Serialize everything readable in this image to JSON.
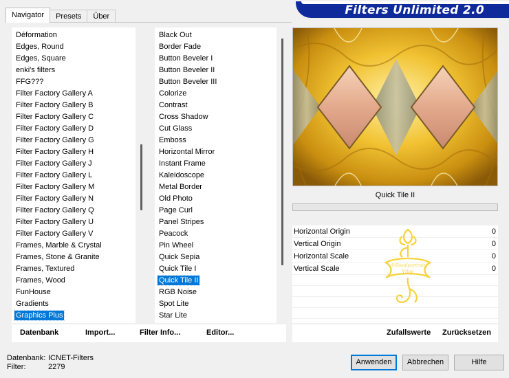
{
  "tabs": [
    "Navigator",
    "Presets",
    "Über"
  ],
  "banner_title": "Filters Unlimited 2.0",
  "categories": [
    "Déformation",
    "Edges, Round",
    "Edges, Square",
    "enki's filters",
    "FFG???",
    "Filter Factory Gallery A",
    "Filter Factory Gallery B",
    "Filter Factory Gallery C",
    "Filter Factory Gallery D",
    "Filter Factory Gallery G",
    "Filter Factory Gallery H",
    "Filter Factory Gallery J",
    "Filter Factory Gallery L",
    "Filter Factory Gallery M",
    "Filter Factory Gallery N",
    "Filter Factory Gallery Q",
    "Filter Factory Gallery U",
    "Filter Factory Gallery V",
    "Frames, Marble & Crystal",
    "Frames, Stone & Granite",
    "Frames, Textured",
    "Frames, Wood",
    "FunHouse",
    "Gradients",
    "Graphics Plus"
  ],
  "category_selected_index": 24,
  "filters": [
    "Black Out",
    "Border Fade",
    "Button Beveler I",
    "Button Beveler II",
    "Button Beveler III",
    "Colorize",
    "Contrast",
    "Cross Shadow",
    "Cut Glass",
    "Emboss",
    "Horizontal Mirror",
    "Instant Frame",
    "Kaleidoscope",
    "Metal Border",
    "Old Photo",
    "Page Curl",
    "Panel Stripes",
    "Peacock",
    "Pin Wheel",
    "Quick Sepia",
    "Quick Tile I",
    "Quick Tile II",
    "RGB Noise",
    "Spot Lite",
    "Star Lite"
  ],
  "filter_selected_index": 21,
  "preview_name": "Quick Tile II",
  "params": [
    {
      "label": "Horizontal Origin",
      "value": "0"
    },
    {
      "label": "Vertical Origin",
      "value": "0"
    },
    {
      "label": "Horizontal Scale",
      "value": "0"
    },
    {
      "label": "Vertical Scale",
      "value": "0"
    }
  ],
  "actions_left": [
    "Datenbank",
    "Import...",
    "Filter Info...",
    "Editor..."
  ],
  "actions_right": [
    "Zufallswerte",
    "Zurücksetzen"
  ],
  "status": {
    "db_label": "Datenbank:",
    "db_value": "ICNET-Filters",
    "filter_label": "Filter:",
    "filter_value": "2279"
  },
  "buttons": {
    "apply": "Anwenden",
    "cancel": "Abbrechen",
    "help": "Hilfe"
  },
  "watermark_text": "©Rosalportrait Vitae",
  "colors": {
    "banner": "#0e2a9b",
    "selection": "#0078d7",
    "default_button_border": "#0078d7"
  }
}
